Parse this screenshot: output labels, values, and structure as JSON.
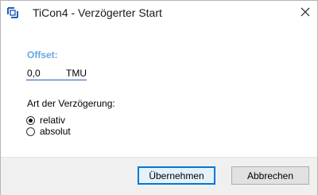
{
  "window": {
    "title": "TiCon4 - Verzögerter Start",
    "app_icon": "ticon-app-icon",
    "close_icon": "close-icon"
  },
  "offset": {
    "label": "Offset:",
    "value": "0,0",
    "unit": "TMU"
  },
  "delay_type": {
    "label": "Art der Verzögerung:",
    "options": [
      {
        "label": "relativ",
        "selected": true
      },
      {
        "label": "absolut",
        "selected": false
      }
    ]
  },
  "buttons": {
    "apply_label": "Übernehmen",
    "cancel_label": "Abbrechen"
  },
  "colors": {
    "offset_label": "#6aa7e0",
    "default_button_border": "#0078d7"
  }
}
